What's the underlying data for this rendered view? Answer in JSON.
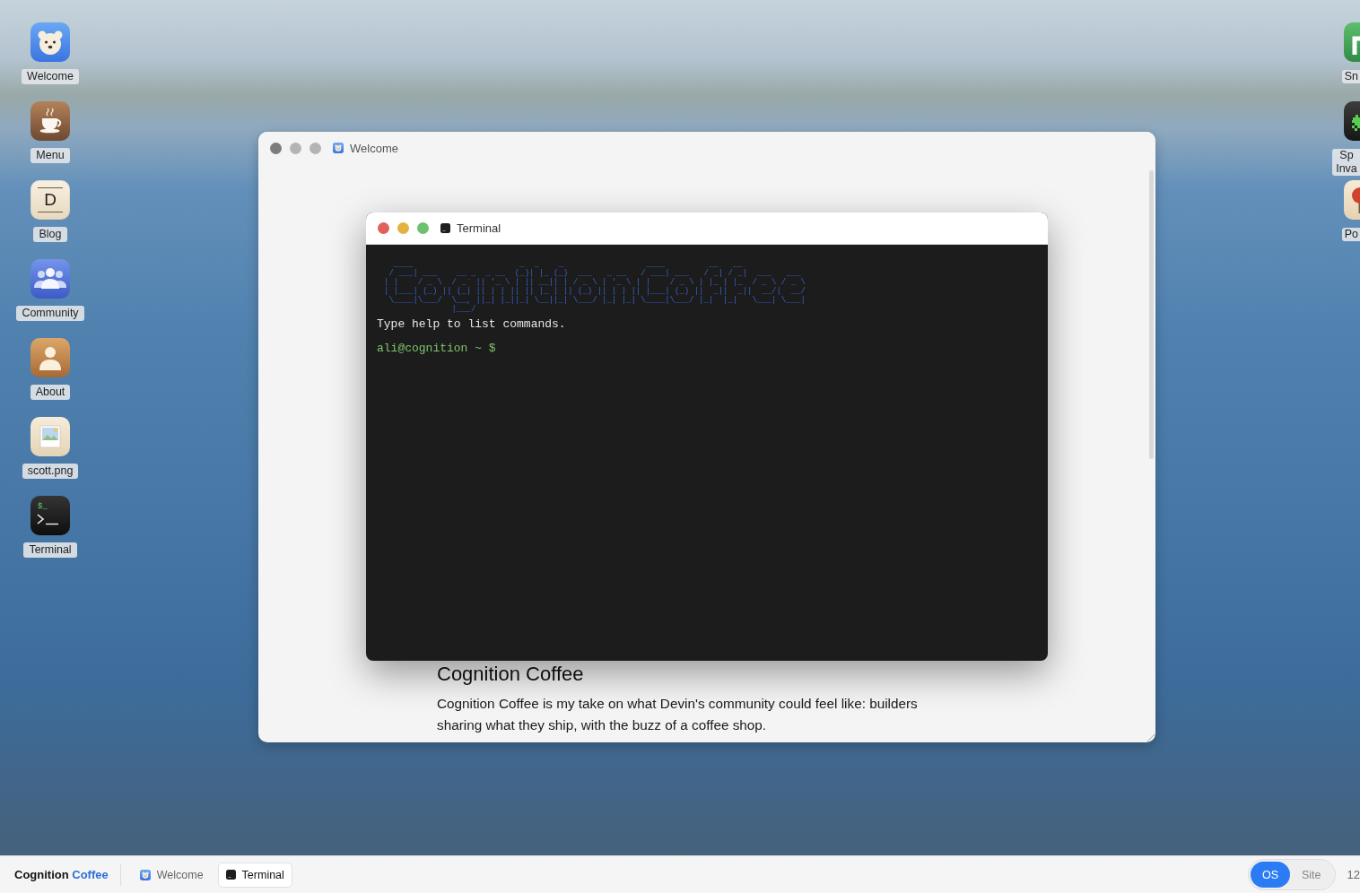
{
  "desktop": {
    "left_icons": [
      {
        "label": "Welcome",
        "kind": "bear"
      },
      {
        "label": "Menu",
        "kind": "coffee"
      },
      {
        "label": "Blog",
        "kind": "letter",
        "glyph": "D"
      },
      {
        "label": "Community",
        "kind": "people"
      },
      {
        "label": "About",
        "kind": "person"
      },
      {
        "label": "scott.png",
        "kind": "image"
      },
      {
        "label": "Terminal",
        "kind": "terminal",
        "glyph": "$_"
      }
    ],
    "right_icons": [
      {
        "label": "Sn",
        "kind": "app"
      },
      {
        "label": "Sp Inva",
        "kind": "alien"
      },
      {
        "label": "Po",
        "kind": "pin"
      }
    ]
  },
  "windows": [
    {
      "kind": "page",
      "title": "Welcome",
      "focused": false,
      "heading": "Cognition Coffee",
      "paragraph": "Cognition Coffee is my take on what Devin's community could feel like: builders sharing what they ship, with the buzz of a coffee shop."
    },
    {
      "kind": "terminal",
      "title": "Terminal",
      "focused": true,
      "banner": [
        "  ____                      _  _    _                 ____         __   __",
        " / ___| ___    __ _  _ __  (_)| |_ (_)  ___   _ __   / ___| ___   / _| / _|  ___   ___",
        "| |    / _ \\  / _` || '_ \\ | || __|| | / _ \\ | '_ \\ | |    / _ \\ | |_ | |_  / _ \\ / _ \\",
        "| |___| (_) || (_| || | | || || |_ | || (_) || | | || |___| (_) ||  _||  _||  __/|  __/",
        " \\____|\\___/  \\__, ||_| |_||_| \\__||_| \\___/ |_| |_| \\____|\\___/ |_|  |_|   \\___| \\___|",
        "              |___/"
      ],
      "hint": "Type help to list commands.",
      "prompt": "ali@cognition ~ $"
    }
  ],
  "taskbar": {
    "brand": [
      {
        "text": "Cognition",
        "accent": false
      },
      {
        "text": "Coffee",
        "accent": true
      }
    ],
    "items": [
      {
        "label": "Welcome",
        "kind": "page",
        "selected": false
      },
      {
        "label": "Terminal",
        "kind": "terminal",
        "selected": true
      }
    ],
    "modes": [
      {
        "label": "OS",
        "selected": true
      },
      {
        "label": "Site",
        "selected": false
      }
    ],
    "clock": "12"
  }
}
